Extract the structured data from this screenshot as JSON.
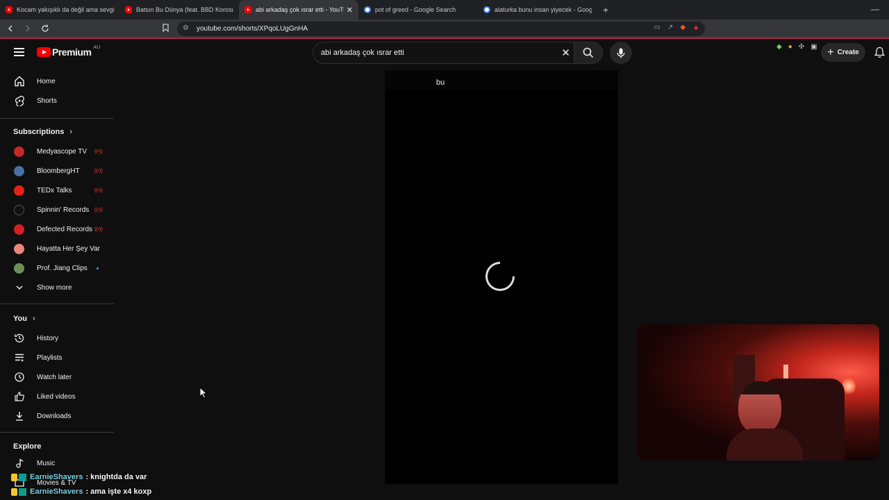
{
  "browser": {
    "tabs": [
      {
        "title": "Kocam yakışıklı da değil ama sevgilim",
        "favicon": "youtube-icon",
        "active": false
      },
      {
        "title": "Batsın Bu Dünya (feat. BBD Korosu)",
        "favicon": "youtube-icon",
        "active": false
      },
      {
        "title": "abi arkadaş çok ısrar etti - YouTube",
        "favicon": "youtube-icon",
        "active": true
      },
      {
        "title": "pot of greed - Google Search",
        "favicon": "google-icon",
        "active": false
      },
      {
        "title": "alaturka bunu insan yiyecek - Google",
        "favicon": "google-icon",
        "active": false
      }
    ],
    "url": "youtube.com/shorts/XPqoLUgGnHA"
  },
  "youtube": {
    "logo_text": "Premium",
    "country_code": "AU",
    "search_value": "abi arkadaş çok ısrar etti",
    "create_label": "Create"
  },
  "sidebar": {
    "main": [
      {
        "label": "Home",
        "icon": "home-icon"
      },
      {
        "label": "Shorts",
        "icon": "shorts-icon"
      }
    ],
    "subscriptions_title": "Subscriptions",
    "subscriptions": [
      {
        "label": "Medyascope TV",
        "color": "#c62828",
        "status": "live"
      },
      {
        "label": "BloombergHT",
        "color": "#4a6fa5",
        "status": "live"
      },
      {
        "label": "TEDx Talks",
        "color": "#e62117",
        "status": "live"
      },
      {
        "label": "Spinnin' Records",
        "color": "#111111",
        "status": "live"
      },
      {
        "label": "Defected Records",
        "color": "#d61f26",
        "status": "live"
      },
      {
        "label": "Hayatta Her Şey Var",
        "color": "#e9867a",
        "status": "none"
      },
      {
        "label": "Prof. Jiang Clips",
        "color": "#6b8f5a",
        "status": "new"
      }
    ],
    "show_more": "Show more",
    "you_title": "You",
    "you": [
      {
        "label": "History",
        "icon": "history-icon"
      },
      {
        "label": "Playlists",
        "icon": "playlists-icon"
      },
      {
        "label": "Watch later",
        "icon": "watch-later-icon"
      },
      {
        "label": "Liked videos",
        "icon": "thumbs-up-icon"
      },
      {
        "label": "Downloads",
        "icon": "download-icon"
      }
    ],
    "explore_title": "Explore",
    "explore": [
      {
        "label": "Music",
        "icon": "music-icon"
      },
      {
        "label": "Movies & TV",
        "icon": "movies-icon"
      }
    ]
  },
  "player": {
    "caption": "bu"
  },
  "chat": [
    {
      "user": "EarnieShavers",
      "message": ": knightda da var"
    },
    {
      "user": "EarnieShavers",
      "message": ": ama işte x4 koxp"
    }
  ]
}
